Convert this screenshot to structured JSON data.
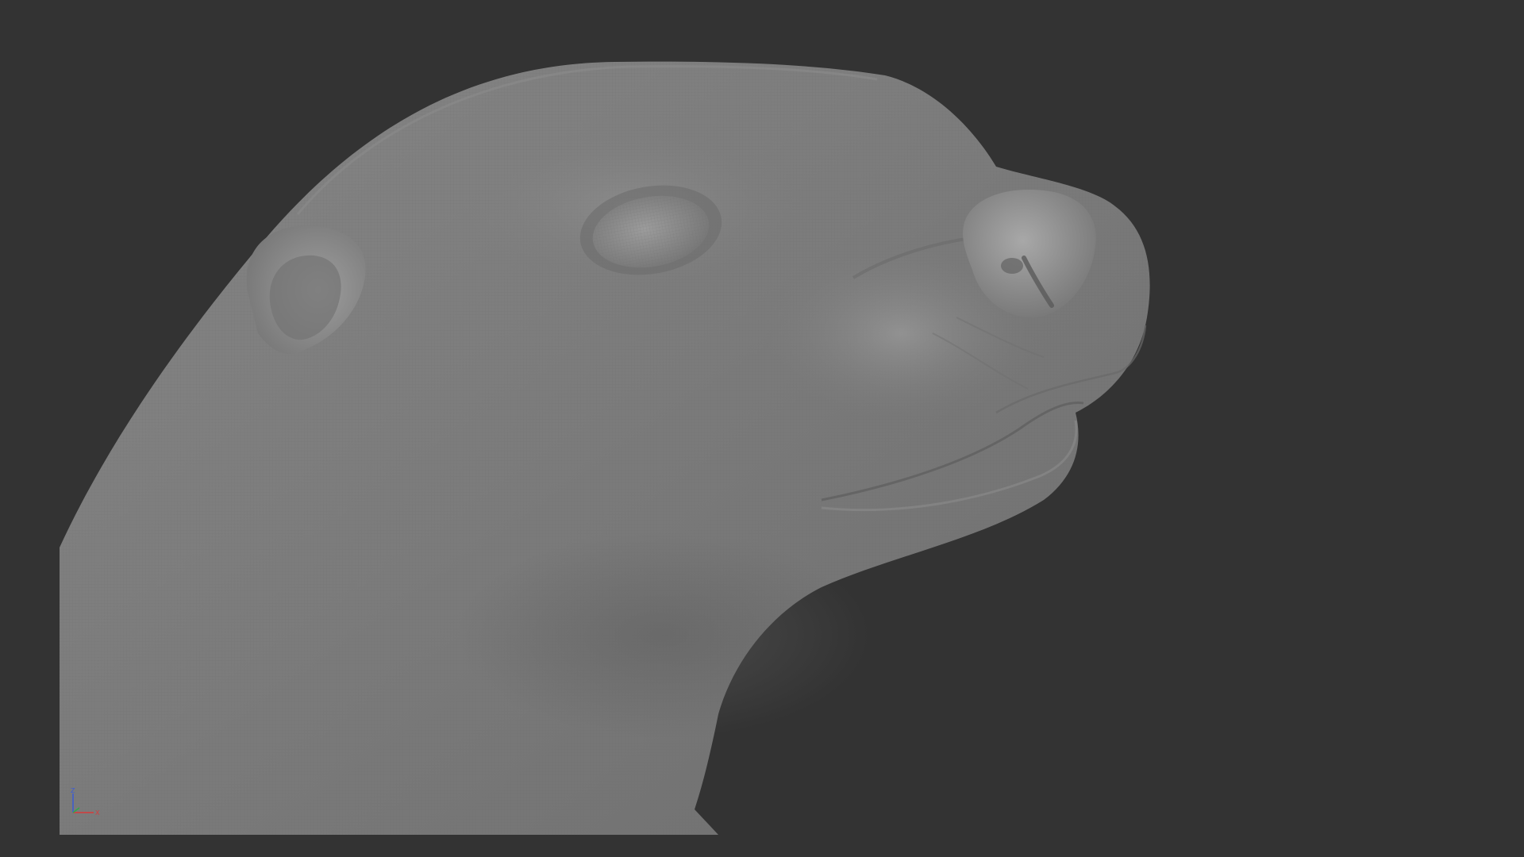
{
  "viewport": {
    "background_color": "#333333",
    "mesh_color": "#7a7a7a",
    "mesh_highlight_color": "#9a9a9a",
    "mesh_shadow_color": "#686868"
  },
  "axis_gizmo": {
    "z_label": "Z",
    "x_label": "X",
    "colors": {
      "z": "#3b5bd6",
      "y": "#2fa84a",
      "x": "#d63b3b"
    }
  }
}
